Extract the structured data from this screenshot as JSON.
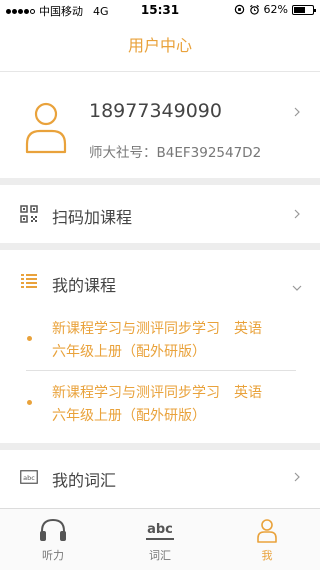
{
  "status_bar": {
    "carrier": "中国移动",
    "network": "4G",
    "time": "15:31",
    "battery": "62%",
    "battery_level": 0.62
  },
  "header": {
    "title": "用户中心"
  },
  "profile": {
    "phone": "18977349090",
    "member_label": "师大社号：",
    "member_id": "B4EF392547D2"
  },
  "menu": {
    "scan": "扫码加课程",
    "my_courses": "我的课程",
    "my_vocab": "我的词汇"
  },
  "courses": [
    {
      "line1": "新课程学习与测评同步学习　英语",
      "line2": "六年级上册（配外研版）"
    },
    {
      "line1": "新课程学习与测评同步学习　英语",
      "line2": "六年级上册（配外研版）"
    }
  ],
  "tabbar": {
    "listen": "听力",
    "vocab": "词汇",
    "abc": "abc",
    "me": "我"
  },
  "colors": {
    "accent": "#e9a23b",
    "text": "#444444",
    "divider": "#ededed"
  }
}
